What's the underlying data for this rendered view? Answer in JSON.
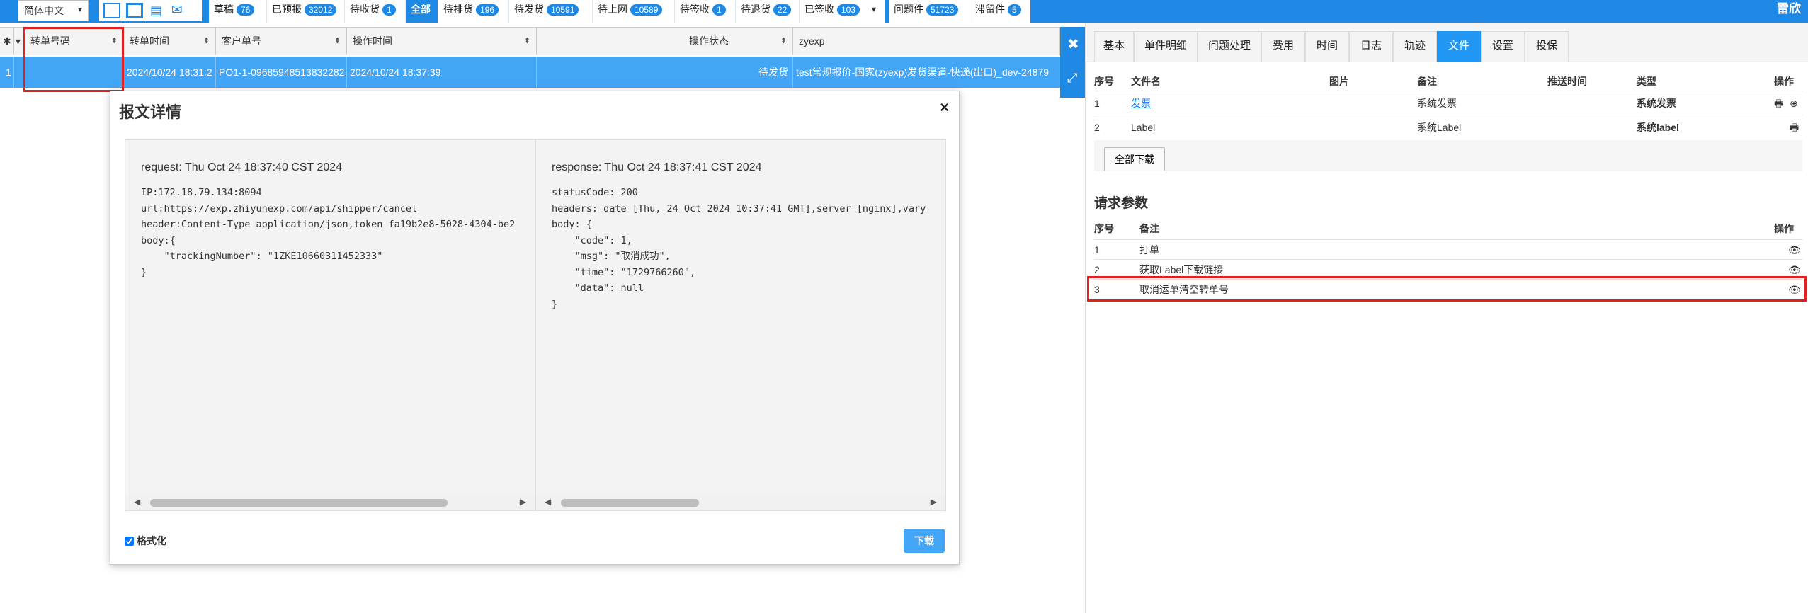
{
  "topbar": {
    "language": "简体中文",
    "user": "雷欣",
    "tabs": [
      {
        "label": "草稿",
        "count": "76"
      },
      {
        "label": "已预报",
        "count": "32012"
      },
      {
        "label": "待收货",
        "count": "1"
      },
      {
        "label": "全部",
        "count": ""
      },
      {
        "label": "待排货",
        "count": "196"
      },
      {
        "label": "待发货",
        "count": "10591"
      },
      {
        "label": "待上网",
        "count": "10589"
      },
      {
        "label": "待签收",
        "count": "1"
      },
      {
        "label": "待退货",
        "count": "22"
      },
      {
        "label": "已签收",
        "count": "103"
      }
    ],
    "extra_tabs": [
      {
        "label": "问题件",
        "count": "51723"
      },
      {
        "label": "滞留件",
        "count": "5"
      }
    ]
  },
  "grid": {
    "headers": [
      "转单号码",
      "转单时间",
      "客户单号",
      "操作时间",
      "操作状态",
      "zyexp"
    ],
    "row": {
      "index": "1",
      "transfer_no": "",
      "transfer_time": "2024/10/24 18:31:2",
      "customer_no": "PO1-1-09685948513832282",
      "op_time": "2024/10/24 18:37:39",
      "status": "待发货",
      "channel": "test常规报价-国家(zyexp)发货渠道-快递(出口)_dev-24879"
    }
  },
  "modal": {
    "title": "报文详情",
    "close": "×",
    "request_head": "request: Thu Oct 24 18:37:40 CST 2024",
    "request_body": "IP:172.18.79.134:8094\nurl:https://exp.zhiyunexp.com/api/shipper/cancel\nheader:Content-Type application/json,token fa19b2e8-5028-4304-be2\nbody:{\n    \"trackingNumber\": \"1ZKE10660311452333\"\n}",
    "response_head": "response: Thu Oct 24 18:37:41 CST 2024",
    "response_body": "statusCode: 200\nheaders: date [Thu, 24 Oct 2024 10:37:41 GMT],server [nginx],vary\nbody: {\n    \"code\": 1,\n    \"msg\": \"取消成功\",\n    \"time\": \"1729766260\",\n    \"data\": null\n}",
    "format_label": "格式化",
    "download_label": "下载"
  },
  "right_panel": {
    "tabs": [
      "基本",
      "单件明细",
      "问题处理",
      "费用",
      "时间",
      "日志",
      "轨迹",
      "文件",
      "设置",
      "投保"
    ],
    "active_tab": "文件",
    "files_headers": [
      "序号",
      "文件名",
      "图片",
      "备注",
      "推送时间",
      "类型",
      "操作"
    ],
    "files": [
      {
        "no": "1",
        "name": "发票",
        "remark": "系统发票",
        "type": "系统发票"
      },
      {
        "no": "2",
        "name": "Label",
        "remark": "系统Label",
        "type": "系统label"
      }
    ],
    "download_all": "全部下载",
    "params_title": "请求参数",
    "params_headers": [
      "序号",
      "备注",
      "操作"
    ],
    "params": [
      {
        "no": "1",
        "remark": "打单"
      },
      {
        "no": "2",
        "remark": "获取Label下载链接"
      },
      {
        "no": "3",
        "remark": "取消运单清空转单号"
      }
    ]
  },
  "colors": {
    "primary": "#1e88e5",
    "row_selected": "#42a5f5",
    "highlight": "#e32020"
  }
}
